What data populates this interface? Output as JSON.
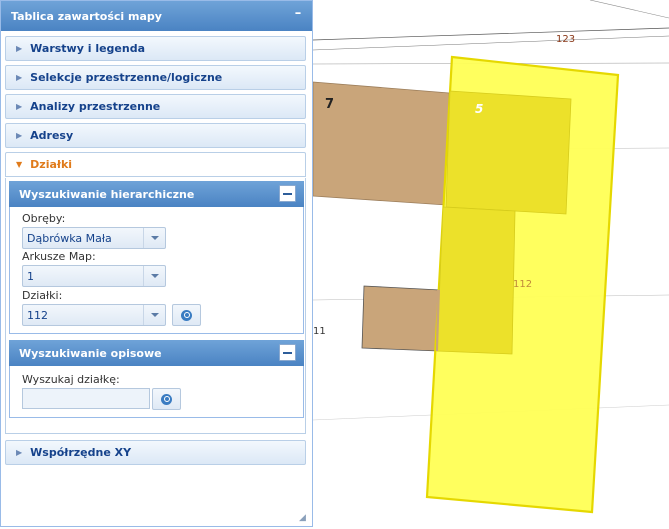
{
  "panel": {
    "title": "Tablica zawartości mapy",
    "collapse_glyph": "–",
    "sections": [
      {
        "label": "Warstwy i legenda",
        "state": "collapsed"
      },
      {
        "label": "Selekcje przestrzenne/logiczne",
        "state": "collapsed"
      },
      {
        "label": "Analizy przestrzenne",
        "state": "collapsed"
      },
      {
        "label": "Adresy",
        "state": "collapsed"
      },
      {
        "label": "Działki",
        "state": "expanded"
      },
      {
        "label": "Współrzędne XY",
        "state": "collapsed"
      }
    ],
    "dzialki": {
      "hierarchical": {
        "title": "Wyszukiwanie hierarchiczne",
        "obreby_label": "Obręby:",
        "obreby_value": "Dąbrówka Mała",
        "arkusze_label": "Arkusze Map:",
        "arkusze_value": "1",
        "dzialki_label": "Działki:",
        "dzialki_value": "112"
      },
      "descriptive": {
        "title": "Wyszukiwanie opisowe",
        "search_label": "Wyszukaj działkę:",
        "search_value": ""
      }
    }
  },
  "map": {
    "labels": {
      "building_7": "7",
      "building_5": "5",
      "parcel_123": "123",
      "parcel_112": "112",
      "parcel_11_fragment": "11"
    },
    "colors": {
      "building": "#c9a57a",
      "highlight_fill": "#ffff55",
      "highlight_stroke": "#e5d800",
      "overlap": "#ece12a"
    }
  },
  "icons": {
    "chevron": "chevron-right-icon",
    "chevron_open": "chevron-down-icon",
    "search": "search-icon",
    "minimize": "minimize-icon",
    "resize": "resize-grip-icon"
  }
}
